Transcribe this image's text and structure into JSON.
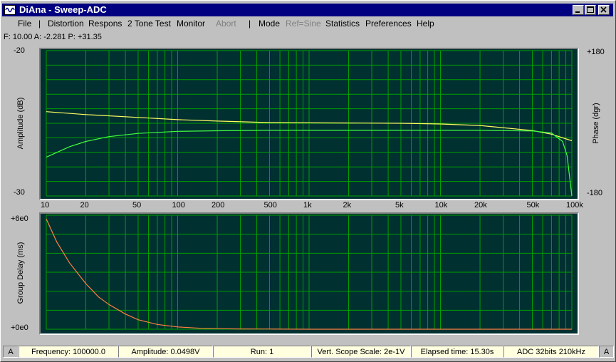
{
  "window": {
    "title": "DiAna - Sweep-ADC",
    "controls": [
      "minimize",
      "maximize",
      "close"
    ]
  },
  "menu": [
    {
      "label": "File",
      "enabled": true
    },
    {
      "label": "|",
      "enabled": true
    },
    {
      "label": "Distortion",
      "enabled": true
    },
    {
      "label": "Respons",
      "enabled": true
    },
    {
      "label": "2 Tone Test",
      "enabled": true
    },
    {
      "label": "Monitor",
      "enabled": true
    },
    {
      "label": "Abort",
      "enabled": false
    },
    {
      "label": "|",
      "enabled": true
    },
    {
      "label": "Mode",
      "enabled": true
    },
    {
      "label": "Ref=Sine",
      "enabled": false
    },
    {
      "label": "Statistics",
      "enabled": true
    },
    {
      "label": "Preferences",
      "enabled": true
    },
    {
      "label": "Help",
      "enabled": true
    }
  ],
  "readout": "F: 10.00  A: -2.281  P: +31.35",
  "colors": {
    "plot_bg": "#003030",
    "grid": "#00a000",
    "amplitude_trace": "#ffff60",
    "phase_trace": "#40ff40",
    "delay_trace": "#ff8040",
    "status_bg": "#ffffe0",
    "titlebar": "#000080"
  },
  "chart_data": [
    {
      "type": "line",
      "title": "",
      "xlabel": "",
      "ylabel": "Amplitude (dB)",
      "y2label": "Phase (dgr)",
      "xscale": "log",
      "xlim": [
        10,
        100000
      ],
      "ylim": [
        -30,
        -20
      ],
      "y2lim": [
        -180,
        180
      ],
      "ytick_labels": [
        "-20",
        "-30"
      ],
      "y2tick_labels": [
        "+180",
        "-180"
      ],
      "xtick_labels": [
        "10",
        "20",
        "50",
        "100",
        "200",
        "500",
        "1k",
        "2k",
        "5k",
        "10k",
        "20k",
        "50k",
        "100k"
      ],
      "xticks": [
        10,
        20,
        50,
        100,
        200,
        500,
        1000,
        2000,
        5000,
        10000,
        20000,
        50000,
        100000
      ],
      "grid": true,
      "series": [
        {
          "axis": "left",
          "x": [
            10,
            20,
            50,
            100,
            200,
            500,
            1000,
            2000,
            5000,
            10000,
            20000,
            50000,
            70000,
            100000
          ],
          "values": [
            -24.2,
            -24.4,
            -24.6,
            -24.75,
            -24.85,
            -24.95,
            -24.97,
            -24.98,
            -25.0,
            -25.05,
            -25.15,
            -25.5,
            -25.75,
            -26.2
          ]
        },
        {
          "axis": "right",
          "x": [
            10,
            15,
            20,
            30,
            50,
            100,
            200,
            500,
            1000,
            5000,
            20000,
            50000,
            70000,
            85000,
            92000,
            100000
          ],
          "values": [
            -84,
            -58,
            -45,
            -33,
            -25,
            -20,
            -18.5,
            -17.5,
            -17.5,
            -17.5,
            -17.5,
            -19,
            -24,
            -45,
            -80,
            -180
          ]
        }
      ]
    },
    {
      "type": "line",
      "title": "",
      "xlabel": "",
      "ylabel": "Group Delay (ms)",
      "xscale": "log",
      "xlim": [
        10,
        100000
      ],
      "ylim": [
        0,
        6
      ],
      "ytick_labels": [
        "+6e0",
        "+0e0"
      ],
      "grid": true,
      "series": [
        {
          "x": [
            10,
            12,
            15,
            20,
            25,
            30,
            40,
            50,
            70,
            100,
            150,
            200,
            300,
            500,
            1000,
            100000
          ],
          "values": [
            5.8,
            4.6,
            3.5,
            2.4,
            1.7,
            1.3,
            0.8,
            0.5,
            0.25,
            0.12,
            0.05,
            0.03,
            0.015,
            0.01,
            0.0,
            0.0
          ]
        }
      ]
    }
  ],
  "status": {
    "left_mark": "A",
    "frequency": "Frequency: 100000.0",
    "amplitude": "Amplitude: 0.0498V",
    "run": "Run: 1",
    "scope_scale": "Vert. Scope Scale: 2e-1V",
    "elapsed": "Elapsed time: 15.30s",
    "adc": "ADC 32bits 210kHz",
    "right_mark": "A"
  }
}
